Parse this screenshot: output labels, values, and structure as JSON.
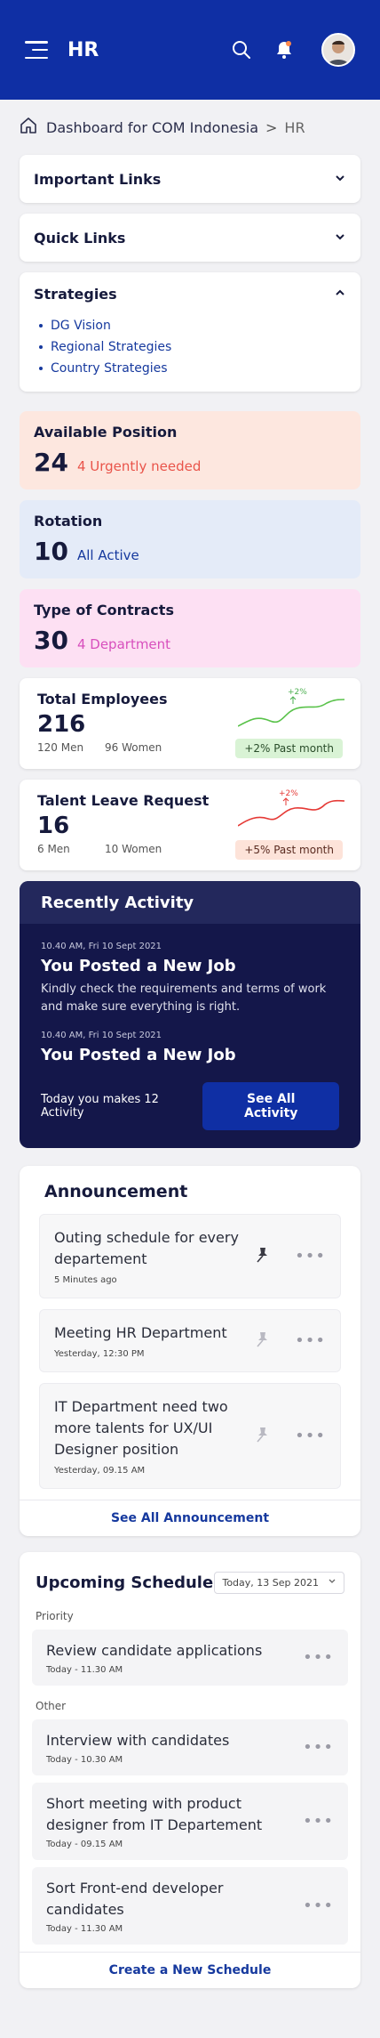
{
  "header": {
    "title": "HR"
  },
  "breadcrumb": {
    "root": "Dashboard for COM Indonesia",
    "separator": ">",
    "current": "HR"
  },
  "accordions": {
    "important_links": "Important Links",
    "quick_links": "Quick Links",
    "strategies": {
      "title": "Strategies",
      "items": [
        "DG Vision",
        "Regional Strategies",
        "Country Strategies"
      ]
    }
  },
  "stats": [
    {
      "label": "Available Position",
      "value": "24",
      "sub": "4 Urgently needed"
    },
    {
      "label": "Rotation",
      "value": "10",
      "sub": "All Active"
    },
    {
      "label": "Type of Contracts",
      "value": "30",
      "sub": "4 Department"
    }
  ],
  "employees": {
    "label": "Total Employees",
    "value": "216",
    "men": "120 Men",
    "women": "96 Women",
    "trend": "+2%",
    "pill": "+2% Past month"
  },
  "leave": {
    "label": "Talent Leave Request",
    "value": "16",
    "men": "6 Men",
    "women": "10 Women",
    "trend": "+2%",
    "pill": "+5% Past month"
  },
  "activity": {
    "title": "Recently Activity",
    "items": [
      {
        "time": "10.40 AM, Fri 10 Sept 2021",
        "title": "You Posted a New Job",
        "desc": "Kindly check the requirements and terms of work and make sure everything is right."
      },
      {
        "time": "10.40 AM, Fri 10 Sept 2021",
        "title": "You Posted a New Job"
      }
    ],
    "footer_note": "Today you makes 12 Activity",
    "button": "See All Activity"
  },
  "announcement": {
    "title": "Announcement",
    "items": [
      {
        "title": "Outing schedule for every departement",
        "time": "5 Minutes ago",
        "pinned": true
      },
      {
        "title": "Meeting HR Department",
        "time": "Yesterday, 12:30 PM",
        "pinned": false
      },
      {
        "title": "IT Department need two more talents for UX/UI Designer position",
        "time": "Yesterday, 09.15 AM",
        "pinned": false
      }
    ],
    "link": "See All Announcement"
  },
  "schedule": {
    "title": "Upcoming Schedule",
    "date": "Today, 13 Sep 2021",
    "priority_label": "Priority",
    "priority": [
      {
        "title": "Review candidate applications",
        "time": "Today - 11.30 AM"
      }
    ],
    "other_label": "Other",
    "other": [
      {
        "title": "Interview with candidates",
        "time": "Today - 10.30 AM"
      },
      {
        "title": "Short meeting with product designer from IT Departement",
        "time": "Today - 09.15 AM"
      },
      {
        "title": "Sort Front-end developer candidates",
        "time": "Today - 11.30 AM"
      }
    ],
    "link": "Create a New Schedule"
  },
  "colors": {
    "brand": "#0f2fa4",
    "activity_bg": "#14174a",
    "link": "#16399e"
  }
}
